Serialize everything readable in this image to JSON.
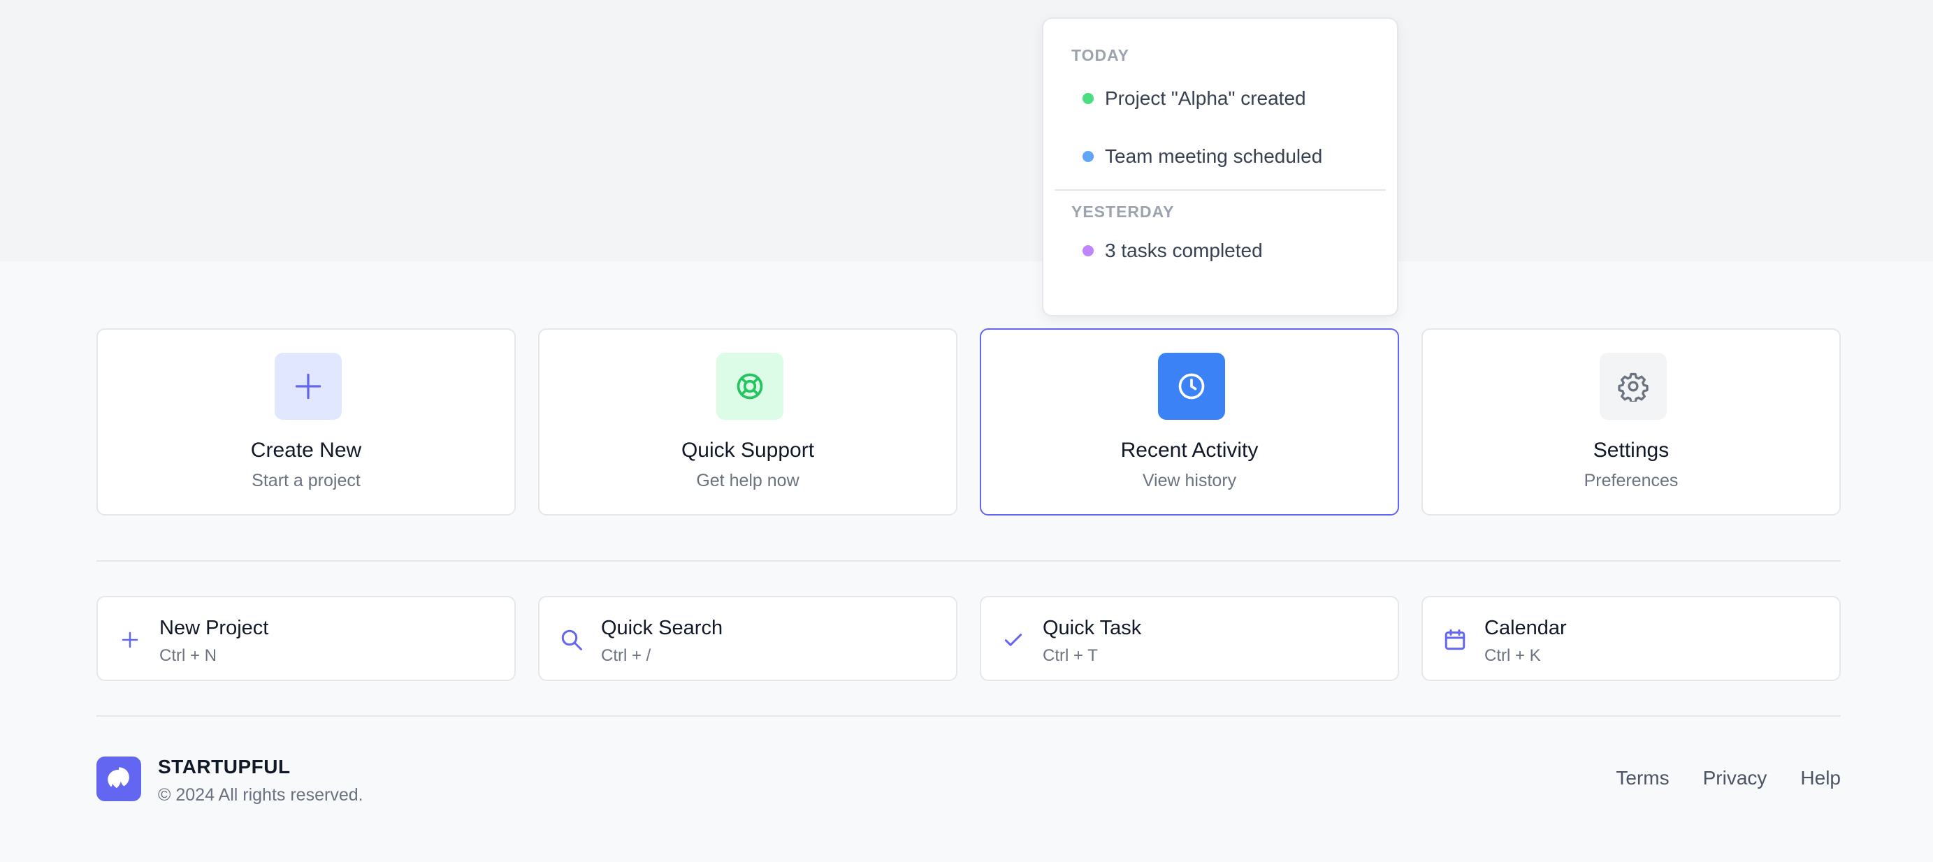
{
  "activity_dropdown": {
    "sections": [
      {
        "title": "TODAY",
        "items": [
          {
            "label": "Project \"Alpha\" created",
            "dot_color": "#4ade80"
          },
          {
            "label": "Team meeting scheduled",
            "dot_color": "#60a5fa"
          }
        ]
      },
      {
        "title": "YESTERDAY",
        "items": [
          {
            "label": "3 tasks completed",
            "dot_color": "#c084fc"
          }
        ]
      }
    ]
  },
  "cards": [
    {
      "title": "Create New",
      "subtitle": "Start a project",
      "icon": "plus-icon",
      "bg": "#e0e7ff",
      "fg": "#6366f1"
    },
    {
      "title": "Quick Support",
      "subtitle": "Get help now",
      "icon": "lifebuoy-icon",
      "bg": "#dcfce7",
      "fg": "#22c55e"
    },
    {
      "title": "Recent Activity",
      "subtitle": "View history",
      "icon": "clock-icon",
      "bg": "#3b82f6",
      "fg": "#ffffff",
      "active": true
    },
    {
      "title": "Settings",
      "subtitle": "Preferences",
      "icon": "gear-icon",
      "bg": "#f3f4f6",
      "fg": "#6b7280"
    }
  ],
  "shortcuts": [
    {
      "title": "New Project",
      "keys": "Ctrl + N",
      "icon": "plus-icon"
    },
    {
      "title": "Quick Search",
      "keys": "Ctrl + /",
      "icon": "search-icon"
    },
    {
      "title": "Quick Task",
      "keys": "Ctrl + T",
      "icon": "check-icon"
    },
    {
      "title": "Calendar",
      "keys": "Ctrl + K",
      "icon": "calendar-icon"
    }
  ],
  "footer": {
    "brand": "STARTUPFUL",
    "copyright": "© 2024 All rights reserved.",
    "links": [
      "Terms",
      "Privacy",
      "Help"
    ]
  },
  "colors": {
    "accent": "#6366f1",
    "border": "#e5e7eb"
  }
}
